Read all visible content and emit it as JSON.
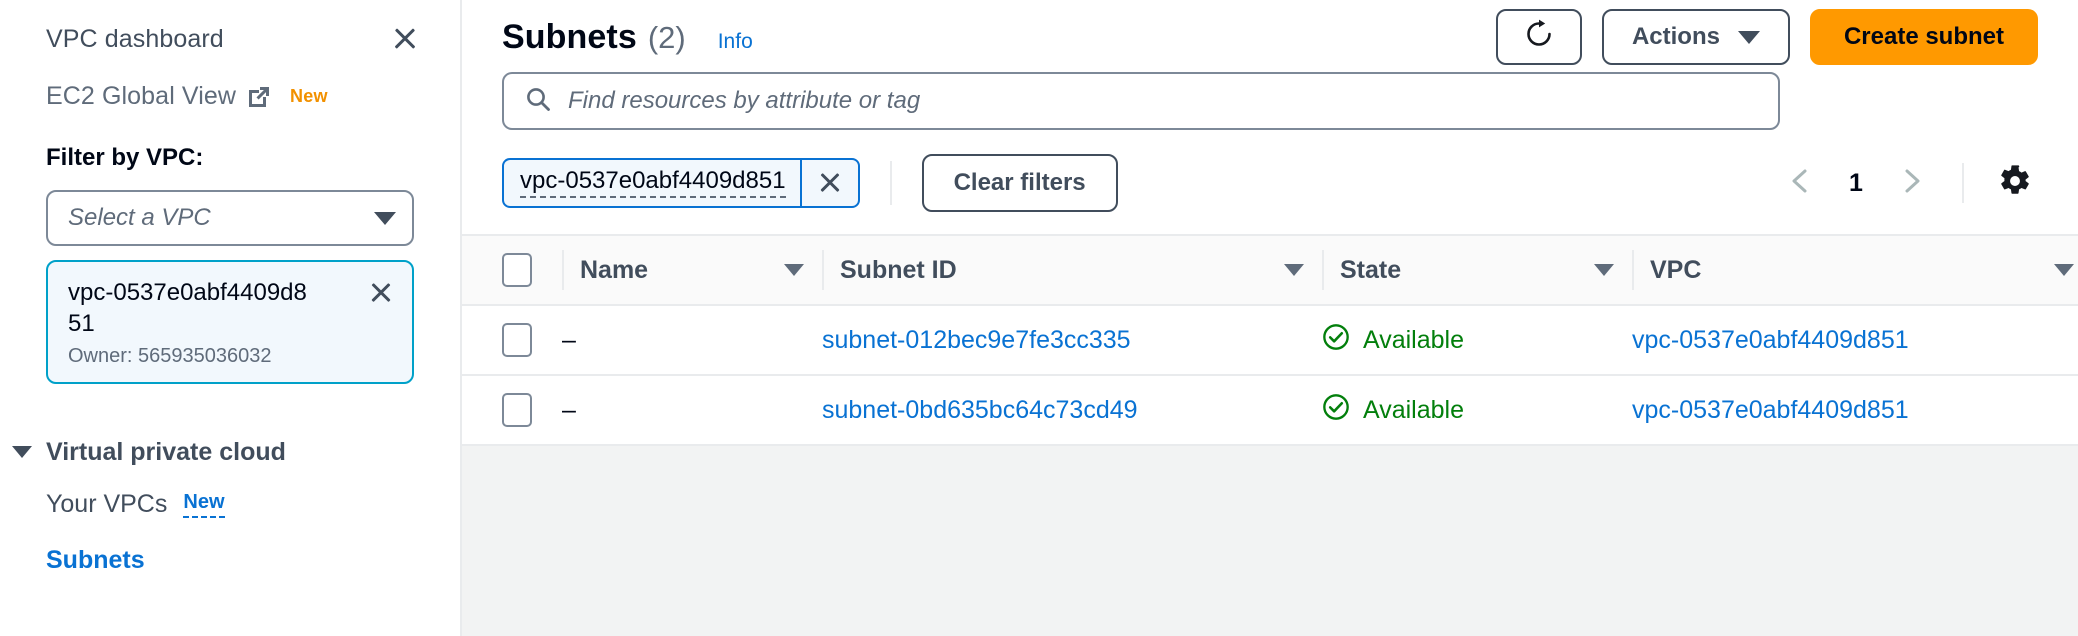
{
  "sidebar": {
    "dashboard_label": "VPC dashboard",
    "close_icon": "close-icon",
    "global_view": {
      "label": "EC2 Global View",
      "external_icon": "external-link-icon",
      "badge": "New"
    },
    "filter_label": "Filter by VPC:",
    "vpc_select": {
      "placeholder": "Select a VPC",
      "caret_icon": "chevron-down-icon"
    },
    "selected_vpc": {
      "id": "vpc-0537e0abf4409d851",
      "owner": "Owner: 565935036032",
      "dismiss_icon": "close-icon"
    },
    "group": {
      "label": "Virtual private cloud",
      "caret_icon": "caret-down-icon"
    },
    "links": [
      {
        "label": "Your VPCs",
        "badge": "New",
        "active": false
      },
      {
        "label": "Subnets",
        "badge": "",
        "active": true
      }
    ]
  },
  "header": {
    "title": "Subnets",
    "count": "(2)",
    "info_link": "Info",
    "refresh_icon": "refresh-icon",
    "actions_label": "Actions",
    "actions_caret_icon": "chevron-down-icon",
    "create_label": "Create subnet"
  },
  "search": {
    "placeholder": "Find resources by attribute or tag",
    "icon": "search-icon",
    "value": ""
  },
  "filters": {
    "token_label": "vpc-0537e0abf4409d851",
    "token_dismiss_icon": "close-icon",
    "clear_label": "Clear filters"
  },
  "pagination": {
    "prev_icon": "chevron-left-icon",
    "page": "1",
    "next_icon": "chevron-right-icon",
    "settings_icon": "gear-icon"
  },
  "table": {
    "columns": [
      {
        "label": "Name",
        "sortable": true
      },
      {
        "label": "Subnet ID",
        "sortable": true
      },
      {
        "label": "State",
        "sortable": true
      },
      {
        "label": "VPC",
        "sortable": true
      }
    ],
    "rows": [
      {
        "name": "–",
        "subnet_id": "subnet-012bec9e7fe3cc335",
        "state": "Available",
        "state_icon": "status-success-icon",
        "vpc": "vpc-0537e0abf4409d851"
      },
      {
        "name": "–",
        "subnet_id": "subnet-0bd635bc64c73cd49",
        "state": "Available",
        "state_icon": "status-success-icon",
        "vpc": "vpc-0537e0abf4409d851"
      }
    ]
  },
  "colors": {
    "primary_orange": "#ff9900",
    "link_blue": "#0972d3",
    "success_green": "#037f0c",
    "border_grey": "#e9ebed",
    "selected_bg": "#f2f8fd",
    "selected_border": "#00a1c9",
    "badge_orange": "#f29100"
  }
}
